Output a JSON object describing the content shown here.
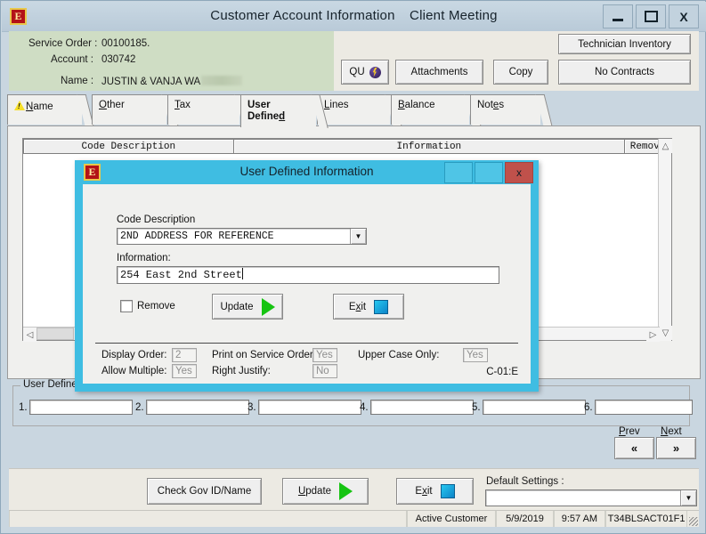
{
  "window": {
    "title_primary": "Customer Account Information",
    "title_secondary": "Client Meeting",
    "logo_text": "E",
    "minimize_label": "Minimize",
    "maximize_label": "Maximize",
    "close_label": "X"
  },
  "header": {
    "service_order_label": "Service Order :",
    "service_order_value": "00100185.",
    "account_label": "Account :",
    "account_value": "030742",
    "name_label": "Name :",
    "name_value": "JUSTIN & VANJA WA",
    "buttons": {
      "qu": "QU",
      "attachments": "Attachments",
      "copy": "Copy",
      "no_contracts": "No Contracts",
      "technician_inventory": "Technician Inventory"
    }
  },
  "tabs": [
    {
      "label": "Name",
      "accel": "N",
      "warning": true,
      "selected": false
    },
    {
      "label": "Other",
      "accel": "O",
      "warning": false,
      "selected": false
    },
    {
      "label": "Tax",
      "accel": "T",
      "warning": false,
      "selected": false
    },
    {
      "label": "User Defined",
      "accel": "D",
      "warning": false,
      "selected": true
    },
    {
      "label": "Lines",
      "accel": "L",
      "warning": false,
      "selected": false
    },
    {
      "label": "Balance",
      "accel": "B",
      "warning": false,
      "selected": false
    },
    {
      "label": "Notes",
      "accel": "e",
      "warning": false,
      "selected": false
    }
  ],
  "grid": {
    "columns": [
      "Code Description",
      "Information",
      "Remove"
    ],
    "rows": []
  },
  "user_defined_group": {
    "legend": "User Defined",
    "fields": [
      {
        "number": "1.",
        "value": ""
      },
      {
        "number": "2.",
        "value": ""
      },
      {
        "number": "3.",
        "value": ""
      },
      {
        "number": "4.",
        "value": ""
      },
      {
        "number": "5.",
        "value": ""
      },
      {
        "number": "6.",
        "value": ""
      }
    ],
    "prev_label": "Prev",
    "prev_accel": "P",
    "next_label": "Next",
    "next_accel": "N",
    "prev_glyph": "«",
    "next_glyph": "»"
  },
  "toolbar": {
    "check_gov_id": "Check Gov ID/Name",
    "update": "Update",
    "update_accel": "U",
    "exit": "Exit",
    "exit_accel": "x",
    "default_settings_label": "Default Settings :",
    "default_settings_value": ""
  },
  "statusbar": {
    "message": "",
    "customer_state": "Active Customer",
    "date": "5/9/2019",
    "time": "9:57 AM",
    "terminal": "T34BLSACT01F1"
  },
  "dialog": {
    "title": "User Defined Information",
    "logo_text": "E",
    "close_label": "x",
    "code_description_label": "Code Description",
    "code_description_value": "2ND ADDRESS FOR REFERENCE",
    "information_label": "Information:",
    "information_value": "254 East 2nd Street",
    "remove_label": "Remove",
    "remove_checked": false,
    "update_label": "Update",
    "exit_label": "Exit",
    "exit_accel": "x",
    "settings": {
      "display_order_label": "Display Order:",
      "display_order_value": "2",
      "allow_multiple_label": "Allow Multiple:",
      "allow_multiple_value": "Yes",
      "print_on_service_order_label": "Print on Service Order:",
      "print_on_service_order_value": "Yes",
      "right_justify_label": "Right Justify:",
      "right_justify_value": "No",
      "upper_case_only_label": "Upper Case Only:",
      "upper_case_only_value": "Yes"
    },
    "code_ref": "C-01:E"
  },
  "colors": {
    "titlebar": "#c9d8e3",
    "header_green": "#cfddc4",
    "dialog_frame": "#3fbde2",
    "dialog_close": "#c0514b",
    "accent_green": "#16c412",
    "accent_blue": "#27c8f0",
    "warning_yellow": "#f7df26"
  }
}
